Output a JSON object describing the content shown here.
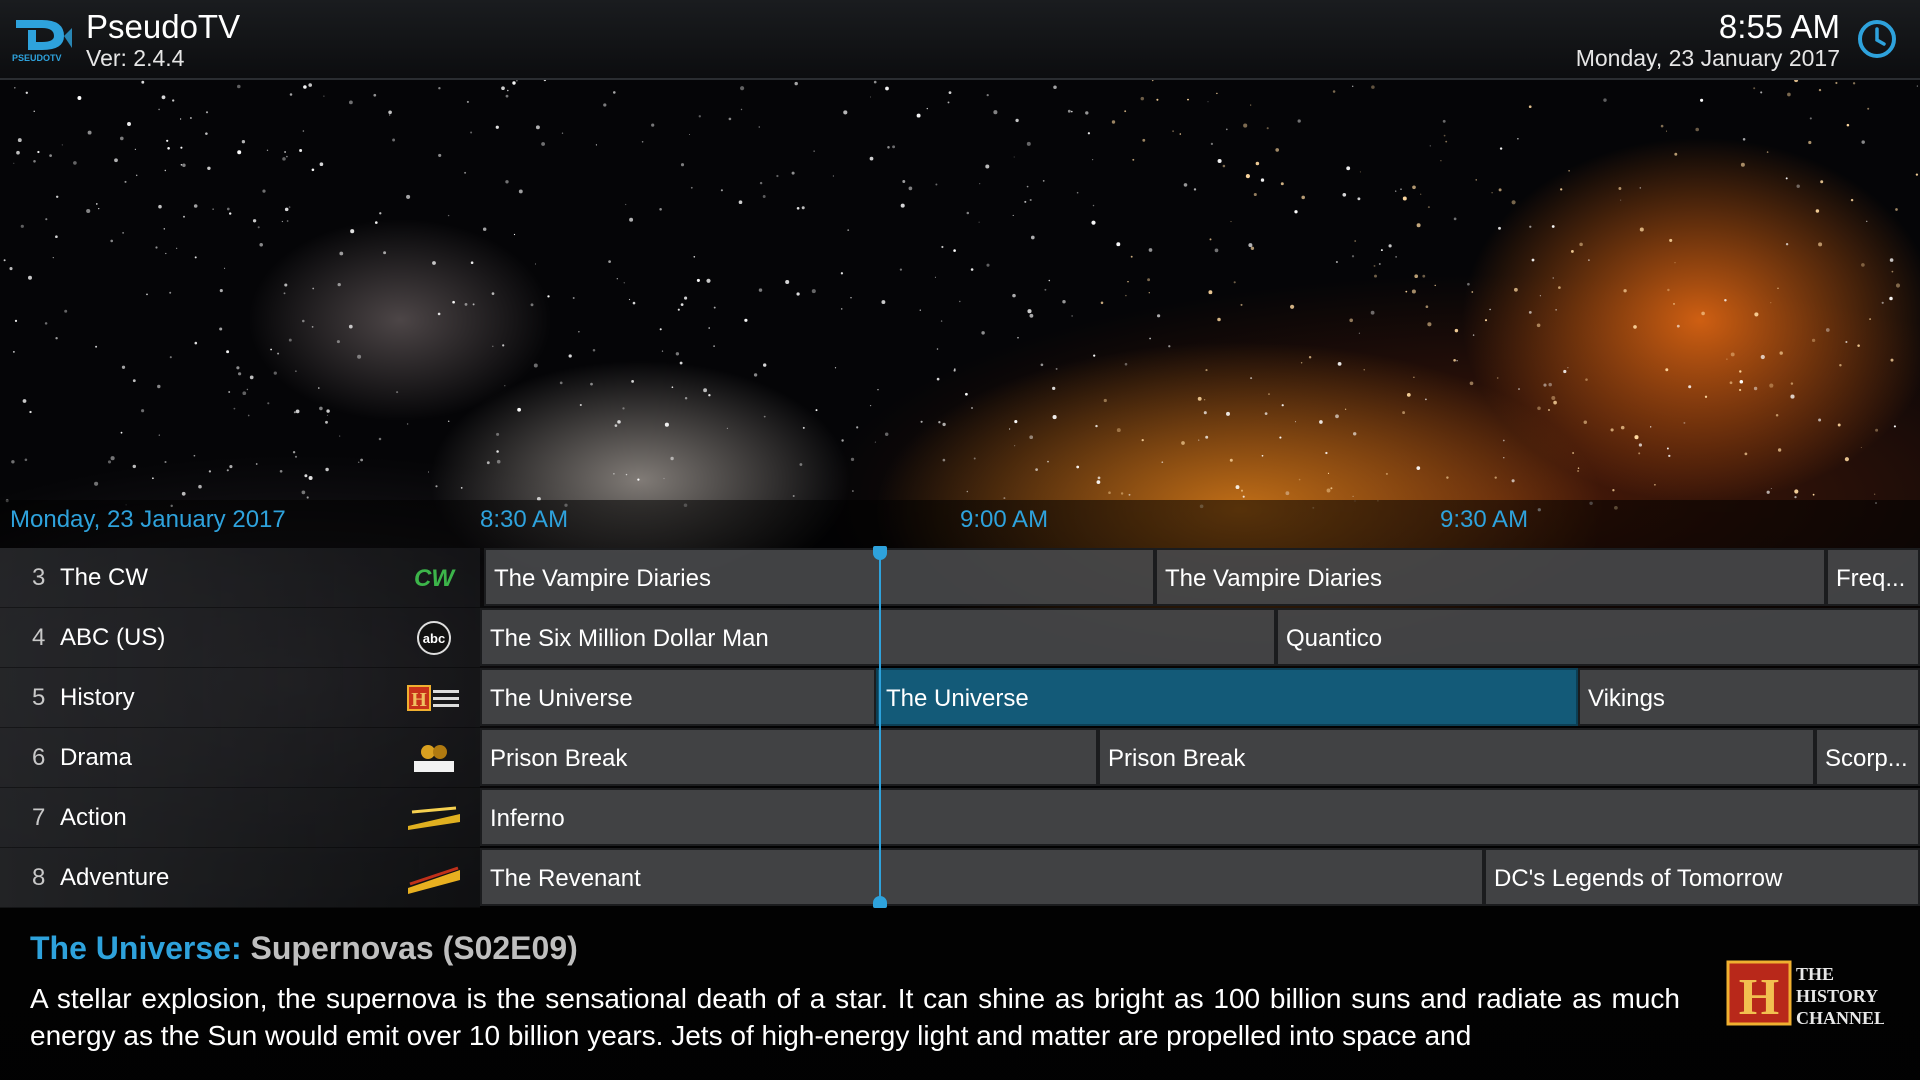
{
  "header": {
    "app_title": "PseudoTV",
    "version": "Ver: 2.4.4",
    "logo_text": "PSEUDOTV",
    "time": "8:55 AM",
    "date": "Monday, 23 January 2017",
    "icon": "clock-icon"
  },
  "timeline": {
    "date": "Monday, 23 January 2017",
    "times": [
      "8:30 AM",
      "9:00 AM",
      "9:30 AM"
    ]
  },
  "channels": [
    {
      "number": "3",
      "name": "The CW",
      "logo": "cw-logo",
      "programs": [
        {
          "title": "The Vampire Diaries"
        },
        {
          "title": "The Vampire Diaries"
        },
        {
          "title": "Freq..."
        }
      ]
    },
    {
      "number": "4",
      "name": "ABC (US)",
      "logo": "abc-logo",
      "programs": [
        {
          "title": "The Six Million Dollar Man"
        },
        {
          "title": "Quantico"
        }
      ]
    },
    {
      "number": "5",
      "name": "History",
      "logo": "history-logo",
      "programs": [
        {
          "title": "The Universe"
        },
        {
          "title": "The Universe",
          "selected": true
        },
        {
          "title": "Vikings"
        }
      ]
    },
    {
      "number": "6",
      "name": "Drama",
      "logo": "drama-logo",
      "programs": [
        {
          "title": "Prison Break"
        },
        {
          "title": "Prison Break"
        },
        {
          "title": "Scorp..."
        }
      ]
    },
    {
      "number": "7",
      "name": "Action",
      "logo": "action-logo",
      "programs": [
        {
          "title": "Inferno"
        }
      ]
    },
    {
      "number": "8",
      "name": "Adventure",
      "logo": "adventure-logo",
      "programs": [
        {
          "title": "The Revenant"
        },
        {
          "title": "DC's Legends of Tomorrow"
        }
      ]
    }
  ],
  "info": {
    "show": "The Universe:",
    "episode": "Supernovas (S02E09)",
    "description": "A stellar explosion, the supernova is the sensational death of a star. It can shine as bright as 100 billion suns and radiate as much energy as the Sun would emit over 10 billion years. Jets of high-energy light and matter are propelled into space and",
    "logo_letter": "H",
    "logo_text_1": "THE",
    "logo_text_2": "HISTORY",
    "logo_text_3": "CHANNEL"
  },
  "colors": {
    "accent": "#2ea2dc",
    "selected_program": "#135a78",
    "program_cell": "#46484a"
  }
}
